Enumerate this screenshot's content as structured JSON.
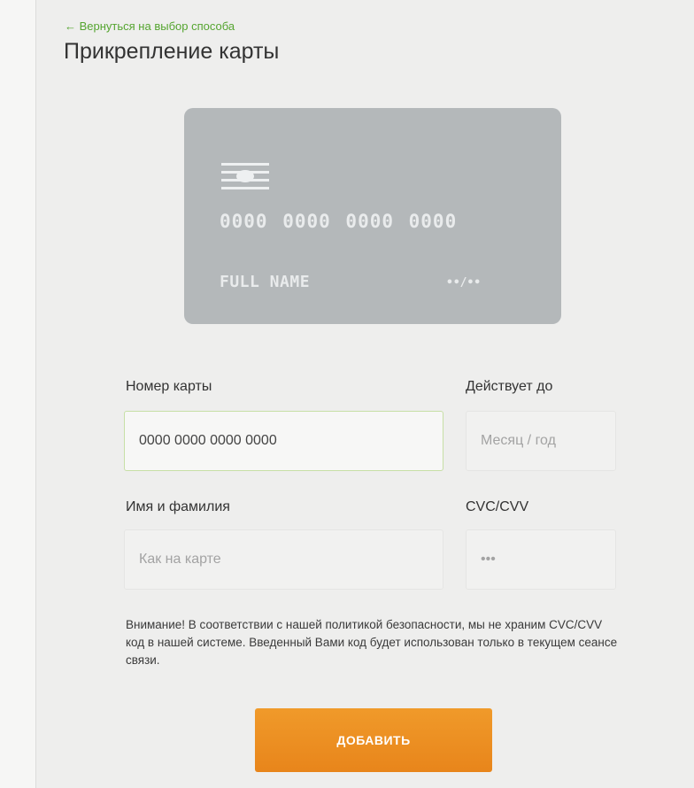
{
  "header": {
    "back_link": "← Вернуться на выбор способа",
    "title": "Прикрепление карты"
  },
  "card_preview": {
    "number": "0000 0000 0000 0000",
    "name": "FULL NAME",
    "expiry": "••/••",
    "chip_icon": "card-chip-icon",
    "background_color": "#b4b8ba"
  },
  "form": {
    "card_number": {
      "label": "Номер карты",
      "value": "0000 0000 0000 0000",
      "placeholder": ""
    },
    "expiry": {
      "label": "Действует до",
      "value": "",
      "placeholder": "Месяц / год"
    },
    "holder_name": {
      "label": "Имя и фамилия",
      "value": "",
      "placeholder": "Как на карте"
    },
    "cvc": {
      "label": "CVC/CVV",
      "value": "",
      "placeholder": "•••"
    }
  },
  "notice": "Внимание! В соответствии с нашей политикой безопасности, мы не храним CVC/CVV код в нашей системе. Введенный Вами код будет использован только в текущем сеансе связи.",
  "submit_label": "ДОБАВИТЬ",
  "colors": {
    "accent_green": "#55a530",
    "button_orange": "#ec8f22",
    "page_background": "#eeeeed"
  }
}
